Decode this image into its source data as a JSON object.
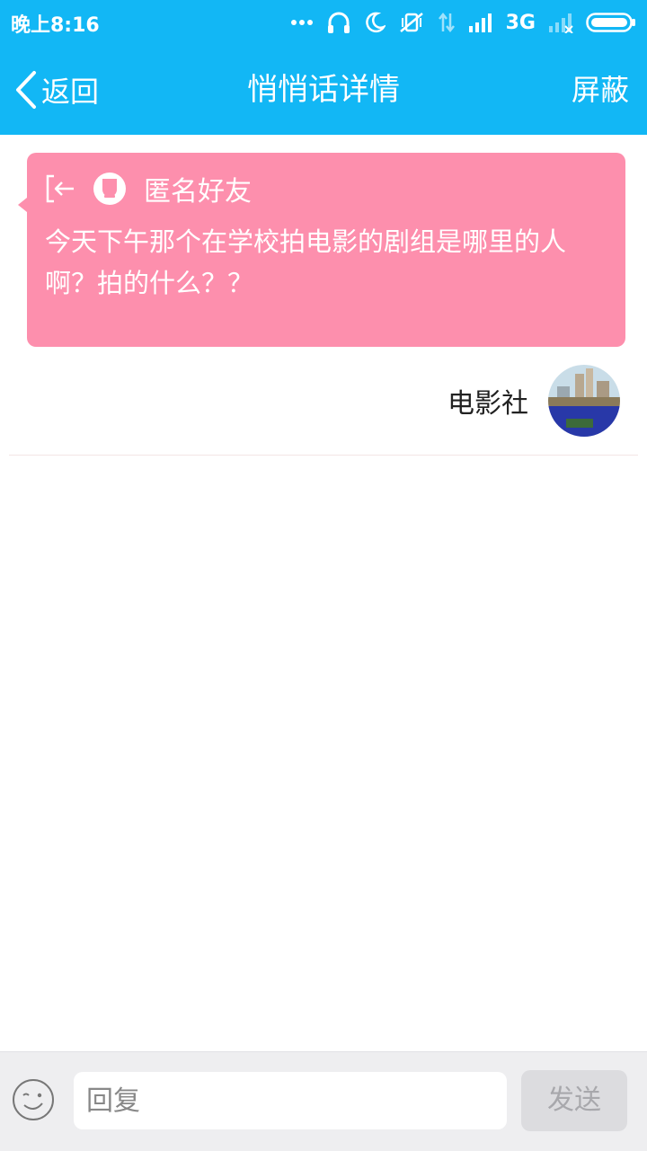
{
  "status_bar": {
    "time": "晚上8:16",
    "network": "3G"
  },
  "nav": {
    "back_label": "返回",
    "title": "悄悄话详情",
    "action_label": "屏蔽"
  },
  "message": {
    "sender": "匿名好友",
    "text": "今天下午那个在学校拍电影的剧组是哪里的人啊？拍的什么？？",
    "card_color": "#fd8fad"
  },
  "recipient": {
    "name": "电影社"
  },
  "reply": {
    "placeholder": "回复",
    "value": "",
    "send_label": "发送"
  },
  "colors": {
    "accent": "#12b7f5",
    "send_disabled": "#dcdcdf"
  }
}
